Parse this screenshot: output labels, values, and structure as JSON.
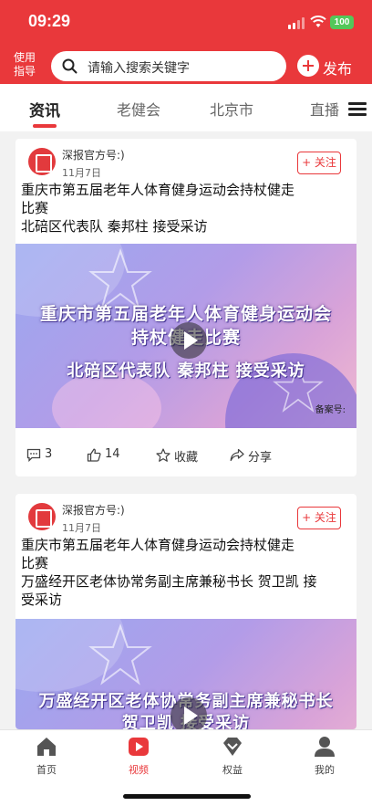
{
  "status_bar": {
    "time": "09:29",
    "battery": "100"
  },
  "header": {
    "guide_line1": "使用",
    "guide_line2": "指导",
    "search_placeholder": "请输入搜索关键字",
    "publish_label": "发布"
  },
  "tabs": [
    {
      "label": "资讯",
      "active": true
    },
    {
      "label": "老健会",
      "active": false
    },
    {
      "label": "北京市",
      "active": false
    },
    {
      "label": "直播",
      "active": false
    }
  ],
  "posts": [
    {
      "author": "深报官方号:)",
      "date": "11月7日",
      "follow_label": "+ 关注",
      "title_line1": "重庆市第五届老年人体育健身运动会持杖健走",
      "title_line2": "比赛",
      "title_line3": "北碚区代表队 秦邦柱 接受采访",
      "title_line4": "",
      "video_line1": "重庆市第五届老年人体育健身运动会",
      "video_line2": "持杖健走比赛",
      "video_line3": "北碚区代表队  秦邦柱  接受采访",
      "record_label": "备案号:",
      "comments": "3",
      "likes": "14",
      "favorite_label": "收藏",
      "share_label": "分享"
    },
    {
      "author": "深报官方号:)",
      "date": "11月7日",
      "follow_label": "+ 关注",
      "title_line1": "重庆市第五届老年人体育健身运动会持杖健走",
      "title_line2": "比赛",
      "title_line3": "万盛经开区老体协常务副主席兼秘书长 贺卫凯 接",
      "title_line4": "受采访",
      "video_line1": "万盛经开区老体协常务副主席兼秘书长",
      "video_line2": "贺卫凯  接受采访"
    }
  ],
  "bottom_nav": [
    {
      "label": "首页",
      "icon": "home-icon",
      "active": false
    },
    {
      "label": "视频",
      "icon": "video-icon",
      "active": true
    },
    {
      "label": "权益",
      "icon": "diamond-icon",
      "active": false
    },
    {
      "label": "我的",
      "icon": "person-icon",
      "active": false
    }
  ],
  "colors": {
    "brand_red": "#e9383b",
    "battery_green": "#53c75a",
    "background": "#f2f2f2"
  }
}
